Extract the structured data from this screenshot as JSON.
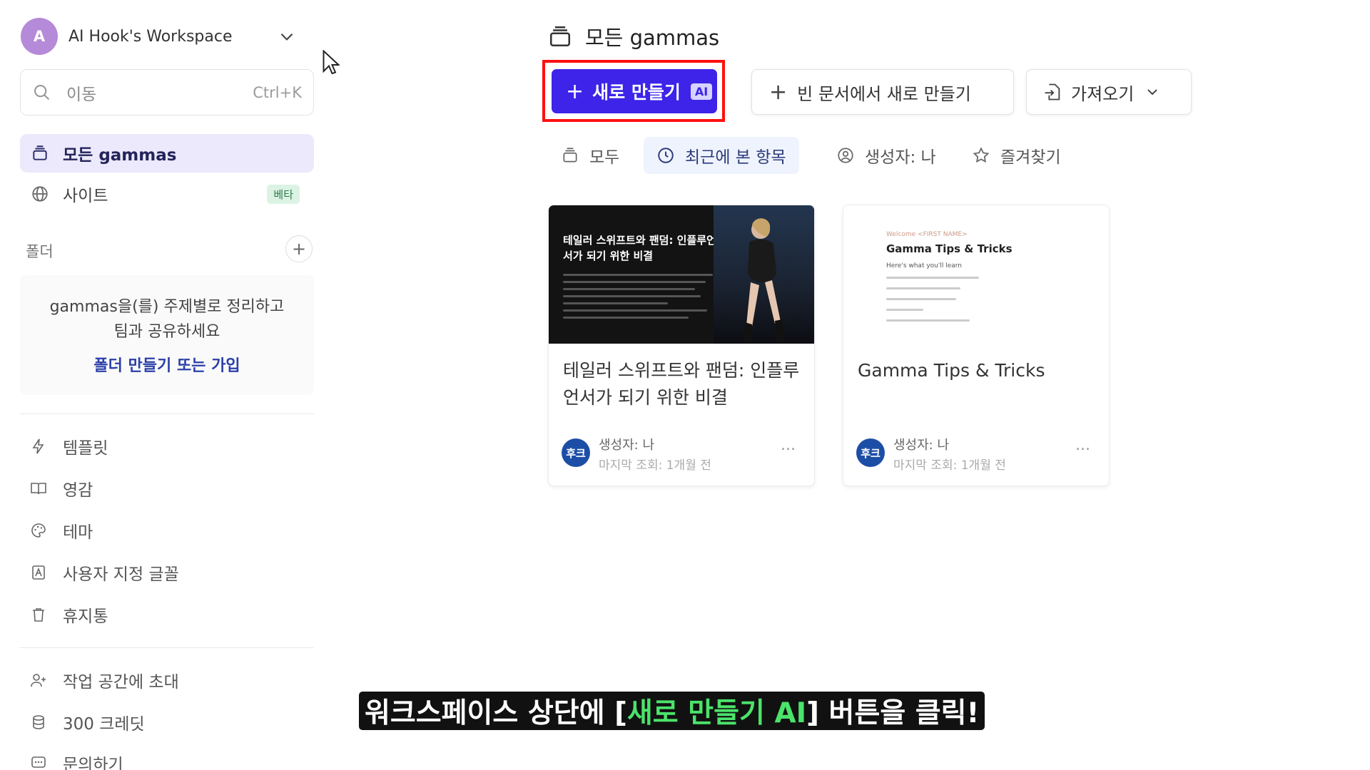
{
  "sidebar": {
    "workspace": {
      "avatar_initial": "A",
      "name": "AI Hook's Workspace"
    },
    "search": {
      "placeholder": "이동",
      "shortcut": "Ctrl+K"
    },
    "nav": [
      {
        "label": "모든 gammas",
        "icon": "stack-icon",
        "active": true
      },
      {
        "label": "사이트",
        "icon": "globe-icon",
        "badge": "베타"
      }
    ],
    "folders": {
      "label": "폴더",
      "empty_text_line1": "gammas을(를) 주제별로 정리하고",
      "empty_text_line2": "팀과 공유하세요",
      "link": "폴더 만들기 또는 가입"
    },
    "links": [
      {
        "label": "템플릿",
        "icon": "lightning-icon"
      },
      {
        "label": "영감",
        "icon": "book-icon"
      },
      {
        "label": "테마",
        "icon": "palette-icon"
      },
      {
        "label": "사용자 지정 글꼴",
        "icon": "font-icon"
      },
      {
        "label": "휴지통",
        "icon": "trash-icon"
      }
    ],
    "bottom": [
      {
        "label": "작업 공간에 초대",
        "icon": "user-plus-icon"
      },
      {
        "label": "300 크레딧",
        "icon": "coins-icon"
      },
      {
        "label": "문의하기",
        "icon": "chat-icon"
      }
    ]
  },
  "main": {
    "title": "모든 gammas",
    "toolbar": {
      "new_label": "새로 만들기",
      "ai_badge": "AI",
      "blank_label": "빈 문서에서 새로 만들기",
      "import_label": "가져오기"
    },
    "filters": [
      {
        "label": "모두",
        "icon": "stack-icon"
      },
      {
        "label": "최근에 본 항목",
        "icon": "clock-icon",
        "active": true
      },
      {
        "label": "생성자: 나",
        "icon": "user-circle-icon"
      },
      {
        "label": "즐겨찾기",
        "icon": "star-icon"
      }
    ],
    "cards": [
      {
        "title": "테일러 스위프트와 팬덤: 인플루언서가 되기 위한 비결",
        "thumb_title": "테일러 스위프트와 팬덤: 인플루언서가 되기 위한 비결",
        "author": "생성자: 나",
        "avatar": "후크",
        "viewed": "마지막 조회: 1개월 전",
        "more": "..."
      },
      {
        "title": "Gamma Tips & Tricks",
        "thumb_small": "Welcome <FIRST NAME>",
        "thumb_title": "Gamma Tips & Tricks",
        "thumb_sub": "Here's what you'll learn",
        "author": "생성자: 나",
        "avatar": "후크",
        "viewed": "마지막 조회: 1개월 전",
        "more": "..."
      }
    ]
  },
  "caption": {
    "before": "워크스페이스 상단에 [",
    "highlight": "새로 만들기 AI",
    "after": "] 버튼을 클릭!"
  },
  "colors": {
    "primary": "#3d24e8",
    "highlight_border": "#ff1010",
    "active_nav_bg": "#ebe9fb",
    "caption_highlight": "#4be36b"
  }
}
